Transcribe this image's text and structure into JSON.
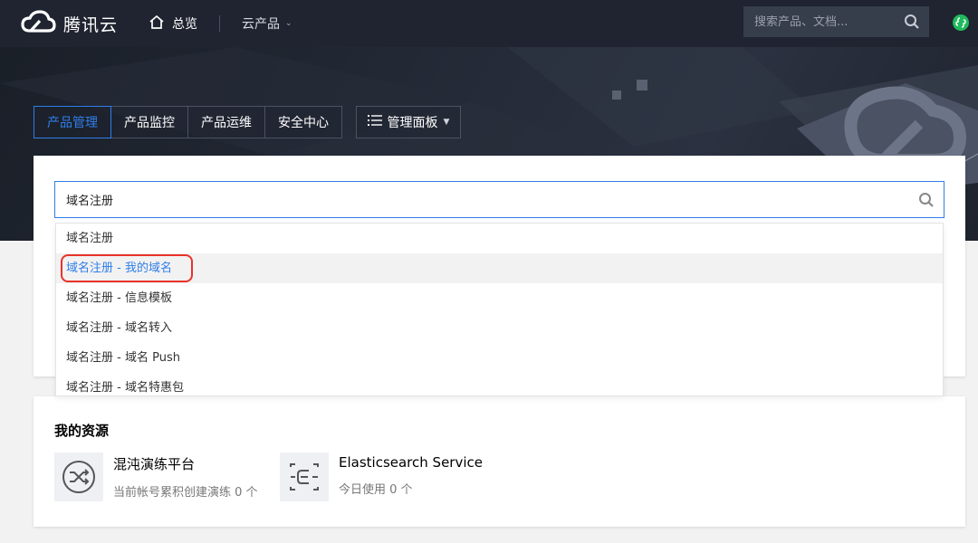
{
  "topnav": {
    "brand": "腾讯云",
    "home_label": "总览",
    "products_label": "云产品",
    "search_placeholder": "搜索产品、文档..."
  },
  "tabs": [
    {
      "label": "产品管理",
      "active": true
    },
    {
      "label": "产品监控",
      "active": false
    },
    {
      "label": "产品运维",
      "active": false
    },
    {
      "label": "安全中心",
      "active": false
    }
  ],
  "panel_button": {
    "label": "管理面板"
  },
  "search": {
    "value": "域名注册"
  },
  "dropdown": {
    "items": [
      {
        "label": "域名注册"
      },
      {
        "label": "域名注册 - 我的域名",
        "selected": true
      },
      {
        "label": "域名注册 - 信息模板"
      },
      {
        "label": "域名注册 - 域名转入"
      },
      {
        "label": "域名注册 - 域名 Push"
      },
      {
        "label": "域名注册 - 域名特惠包"
      }
    ]
  },
  "resources": {
    "title": "我的资源",
    "items": [
      {
        "name": "混沌演练平台",
        "sub": "当前帐号累积创建演练 0 个",
        "icon": "shuffle-icon"
      },
      {
        "name": "Elasticsearch Service",
        "sub": "今日使用 0 个",
        "icon": "elasticsearch-icon"
      }
    ]
  },
  "colors": {
    "topnav_bg": "#1f2430",
    "accent": "#2f7eea",
    "highlight_ring": "#e8332a"
  }
}
